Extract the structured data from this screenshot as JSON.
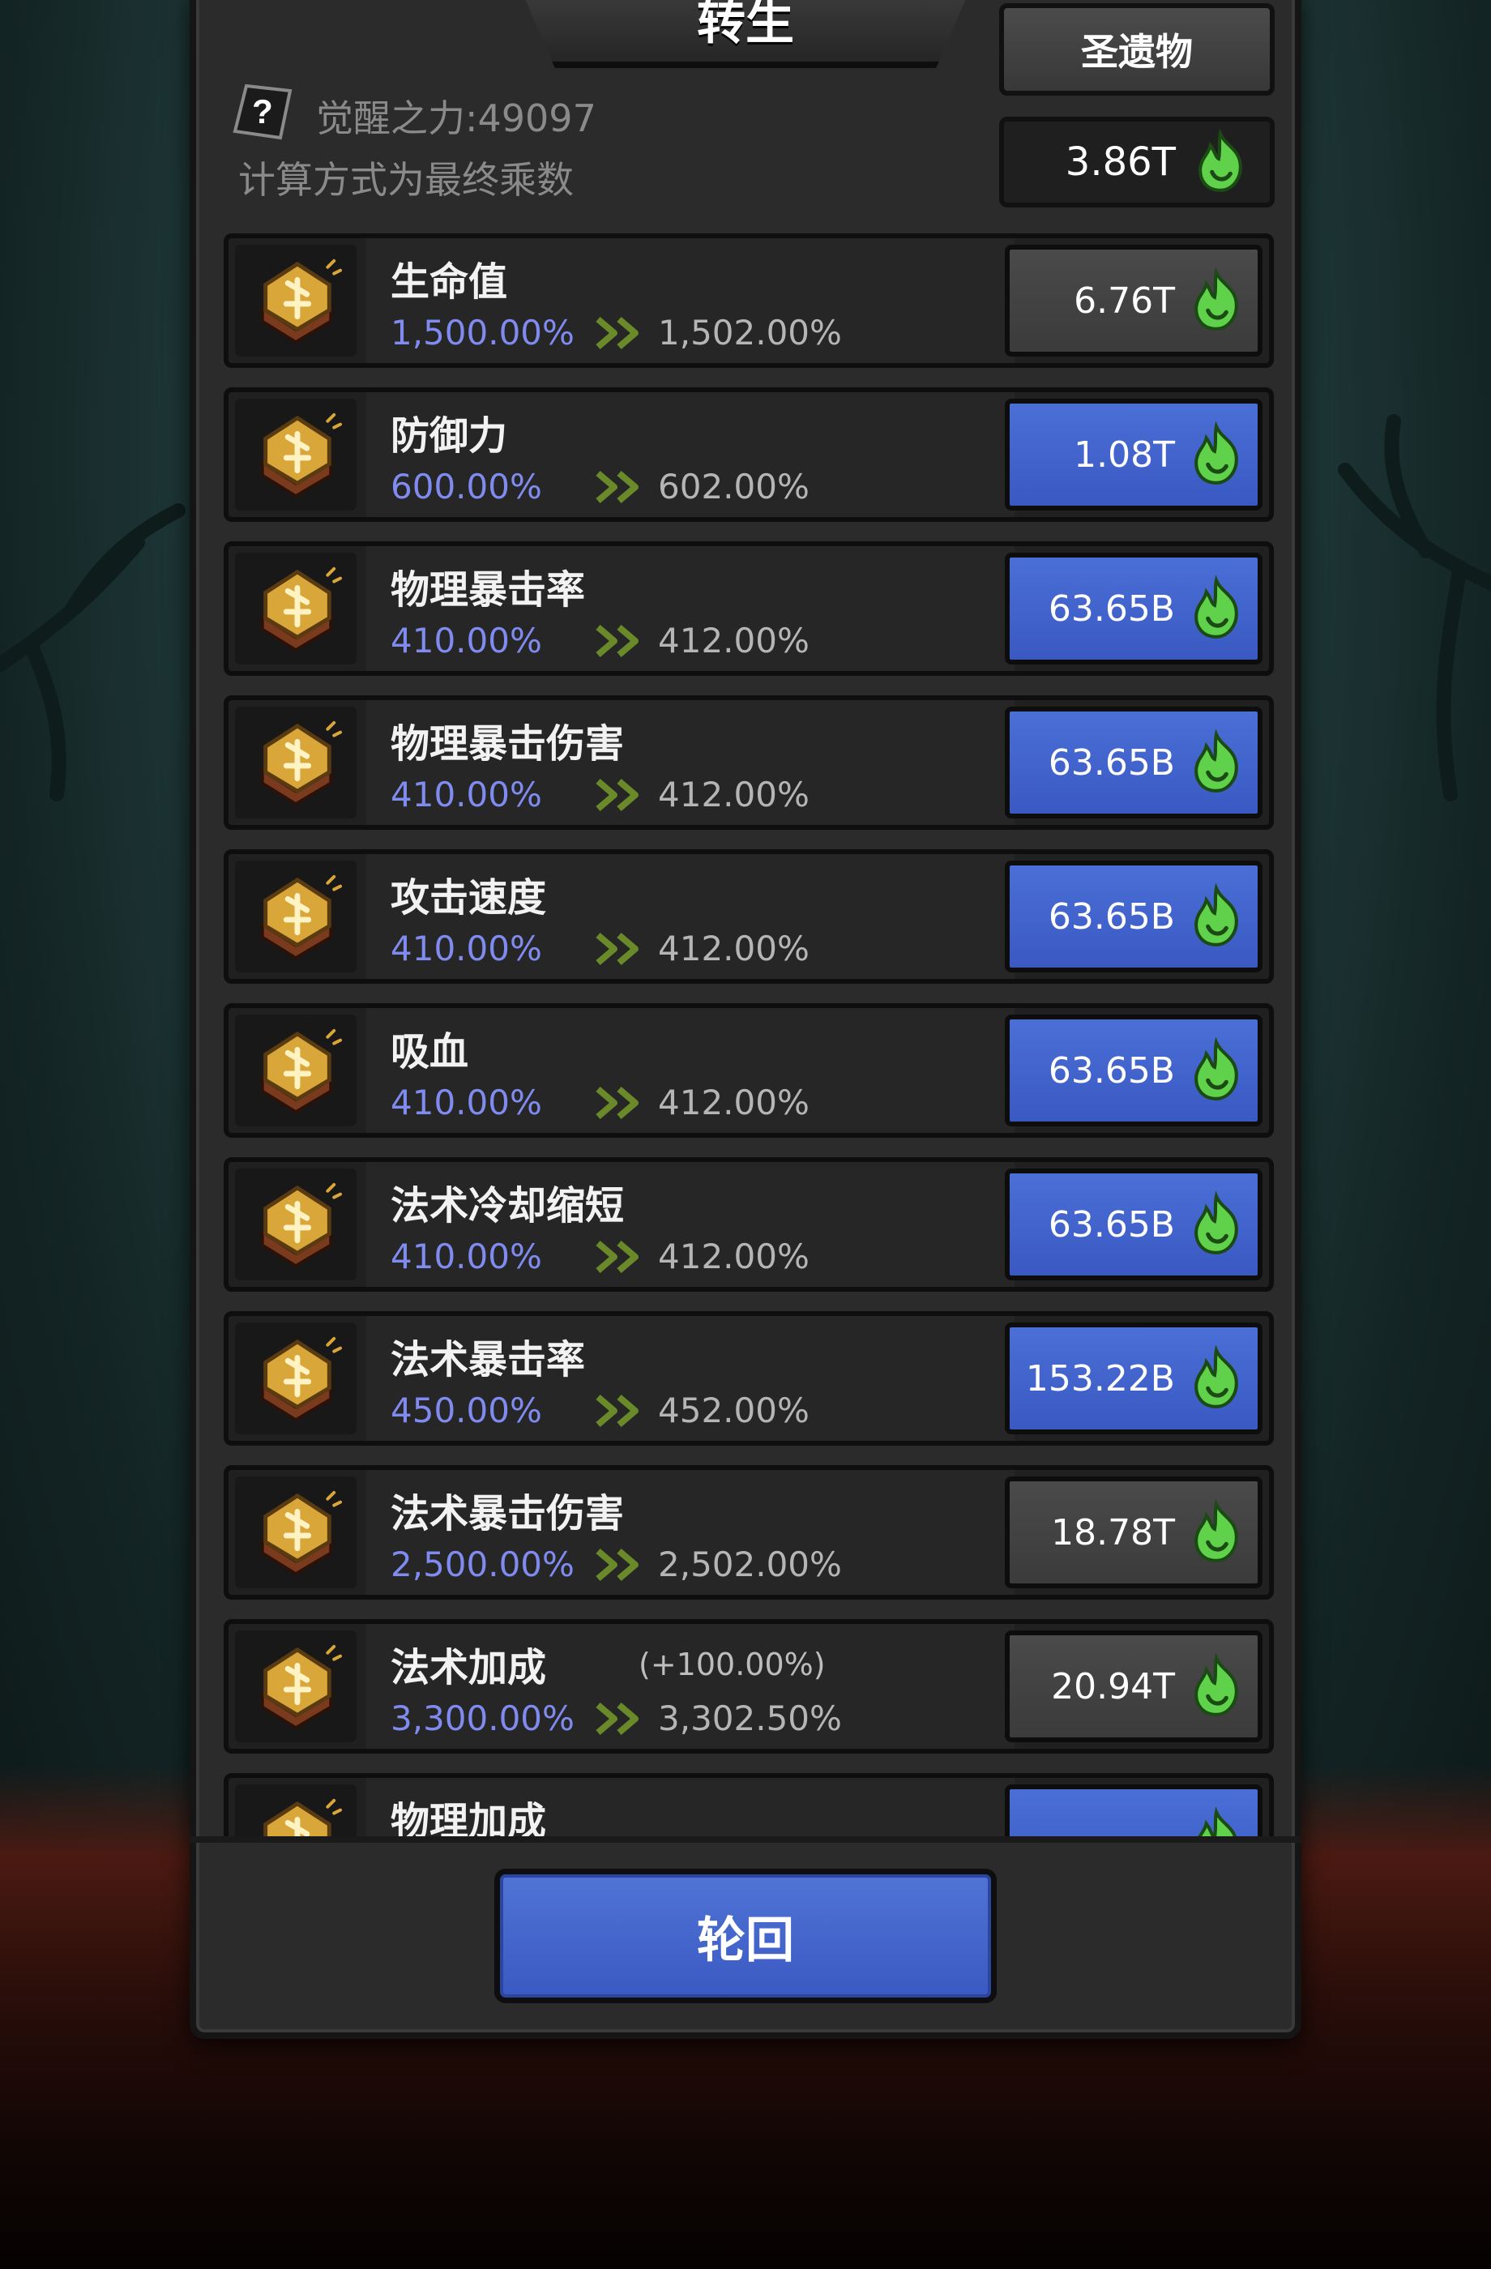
{
  "header": {
    "title": "转生",
    "relic_button": "圣遗物",
    "currency_value": "3.86T",
    "awaken_power": "觉醒之力:49097",
    "calc_note": "计算方式为最终乘数"
  },
  "rows": [
    {
      "name": "生命值",
      "extra": "",
      "current": "1,500.00%",
      "next": "1,502.00%",
      "cost": "6.76T",
      "style": "gray"
    },
    {
      "name": "防御力",
      "extra": "",
      "current": "600.00%",
      "next": "602.00%",
      "cost": "1.08T",
      "style": "blue"
    },
    {
      "name": "物理暴击率",
      "extra": "",
      "current": "410.00%",
      "next": "412.00%",
      "cost": "63.65B",
      "style": "blue"
    },
    {
      "name": "物理暴击伤害",
      "extra": "",
      "current": "410.00%",
      "next": "412.00%",
      "cost": "63.65B",
      "style": "blue"
    },
    {
      "name": "攻击速度",
      "extra": "",
      "current": "410.00%",
      "next": "412.00%",
      "cost": "63.65B",
      "style": "blue"
    },
    {
      "name": "吸血",
      "extra": "",
      "current": "410.00%",
      "next": "412.00%",
      "cost": "63.65B",
      "style": "blue"
    },
    {
      "name": "法术冷却缩短",
      "extra": "",
      "current": "410.00%",
      "next": "412.00%",
      "cost": "63.65B",
      "style": "blue"
    },
    {
      "name": "法术暴击率",
      "extra": "",
      "current": "450.00%",
      "next": "452.00%",
      "cost": "153.22B",
      "style": "blue"
    },
    {
      "name": "法术暴击伤害",
      "extra": "",
      "current": "2,500.00%",
      "next": "2,502.00%",
      "cost": "18.78T",
      "style": "gray"
    },
    {
      "name": "法术加成",
      "extra": "(+100.00%)",
      "current": "3,300.00%",
      "next": "3,302.50%",
      "cost": "20.94T",
      "style": "gray"
    },
    {
      "name": "物理加成",
      "extra": "",
      "current": "",
      "next": "",
      "cost": "",
      "style": "blue"
    }
  ],
  "footer": {
    "rebirth_button": "轮回"
  },
  "icons": {
    "rune": "rune-stone-icon",
    "currency": "green-flame-icon",
    "help": "question-mark-icon",
    "arrow": "double-chevron-icon"
  },
  "colors": {
    "accent_blue": "#3a59c2",
    "flame_green": "#5fd14a",
    "current_value": "#7f8bef",
    "rune_gold": "#d9a63a"
  }
}
